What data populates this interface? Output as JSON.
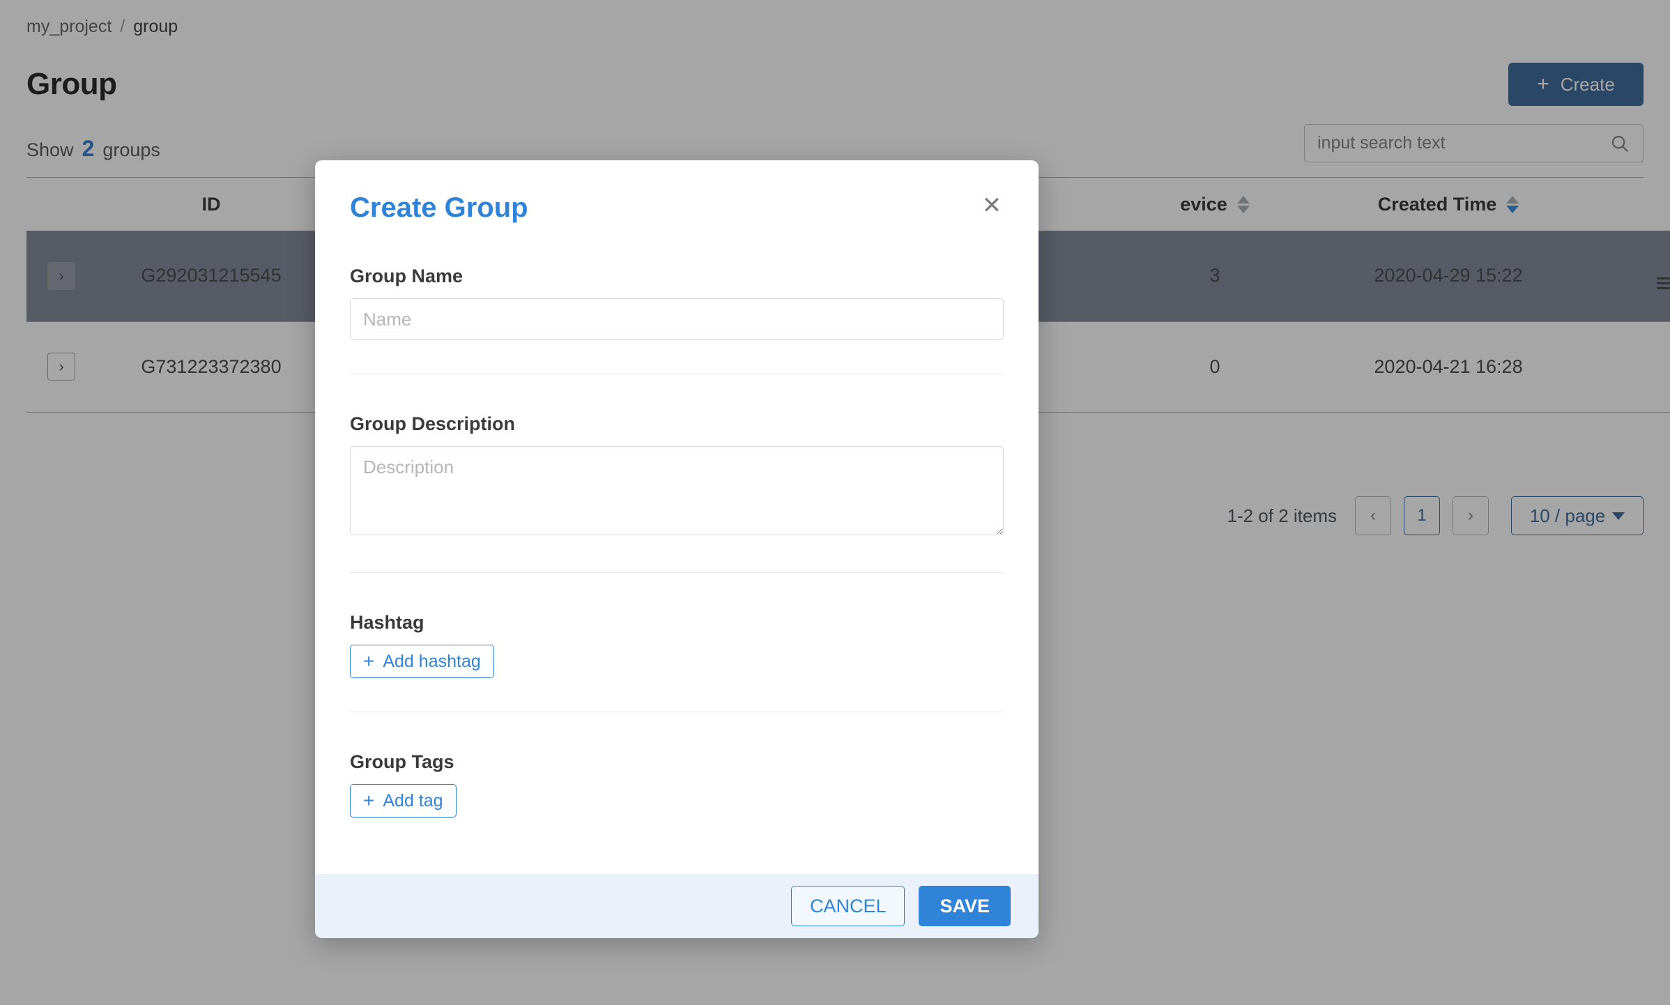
{
  "breadcrumb": {
    "project": "my_project",
    "separator": "/",
    "current": "group"
  },
  "page": {
    "title": "Group",
    "show_prefix": "Show",
    "show_count": "2",
    "show_suffix": "groups"
  },
  "toolbar": {
    "create_label": "Create",
    "create_plus": "+",
    "create_color": "#1d5189"
  },
  "search": {
    "placeholder": "input search text",
    "value": "",
    "icon": "search-icon"
  },
  "table": {
    "columns": [
      {
        "key": "expand",
        "label": ""
      },
      {
        "key": "id",
        "label": "ID",
        "sortable": false
      },
      {
        "key": "name",
        "label": "",
        "sortable": false
      },
      {
        "key": "description",
        "label": "",
        "sortable": false
      },
      {
        "key": "tags",
        "label": "",
        "sortable": false
      },
      {
        "key": "device",
        "label": "evice",
        "sortable": true,
        "sort": "none"
      },
      {
        "key": "created_time",
        "label": "Created Time",
        "sortable": true,
        "sort": "desc"
      },
      {
        "key": "action",
        "label": "",
        "sortable": false
      }
    ],
    "rows": [
      {
        "expand": "›",
        "id": "G292031215545",
        "name": "",
        "description": "",
        "tags": "",
        "device": "3",
        "created_time": "2020-04-29 15:22",
        "highlighted": true
      },
      {
        "expand": "›",
        "id": "G731223372380",
        "name": "",
        "description": "",
        "tags": "",
        "device": "0",
        "created_time": "2020-04-21 16:28",
        "highlighted": false
      }
    ]
  },
  "pagination": {
    "items_label": "1-2 of 2 items",
    "prev_label": "‹",
    "next_label": "›",
    "current_page": "1",
    "page_size_label": "10 / page"
  },
  "modal": {
    "title": "Create Group",
    "close_label": "✕",
    "title_color": "#2f83d8",
    "fields": {
      "group_name": {
        "label": "Group Name",
        "placeholder": "Name",
        "value": ""
      },
      "group_description": {
        "label": "Group Description",
        "placeholder": "Description",
        "value": ""
      },
      "hashtag": {
        "label": "Hashtag",
        "add_label": "Add hashtag",
        "add_plus": "+"
      },
      "group_tags": {
        "label": "Group Tags",
        "add_label": "Add tag",
        "add_plus": "+"
      }
    },
    "footer": {
      "cancel_label": "CANCEL",
      "save_label": "SAVE",
      "save_color": "#2f83d8"
    }
  }
}
